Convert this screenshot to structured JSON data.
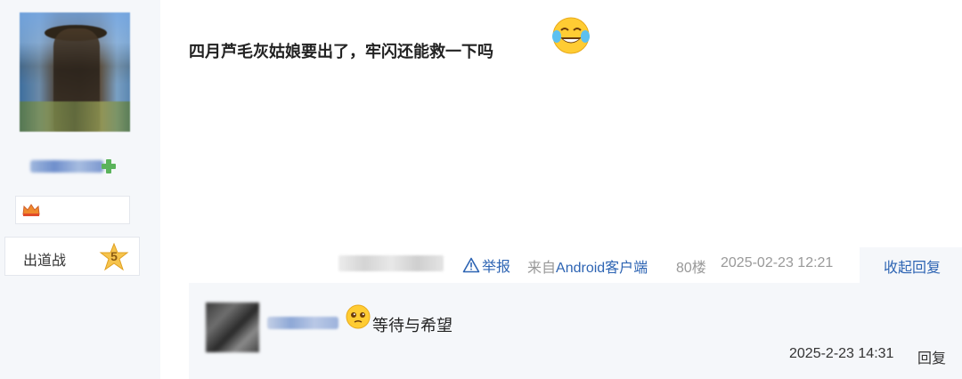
{
  "sidebar": {
    "user_title_label": "出道战",
    "level_number": "5"
  },
  "post": {
    "content": "四月芦毛灰姑娘要出了，牢闪还能救一下吗"
  },
  "meta": {
    "report_label": "举报",
    "source_prefix": "来自",
    "source_brand": "Android客户端",
    "floor": "80楼",
    "time": "2025-02-23 12:21",
    "collapse_label": "收起回复"
  },
  "reply": {
    "text": "等待与希望",
    "time": "2025-2-23 14:31",
    "action_label": "回复"
  },
  "colors": {
    "link": "#2d64b3",
    "meta_gray": "#999999",
    "panel_bg": "#f5f7fa"
  }
}
